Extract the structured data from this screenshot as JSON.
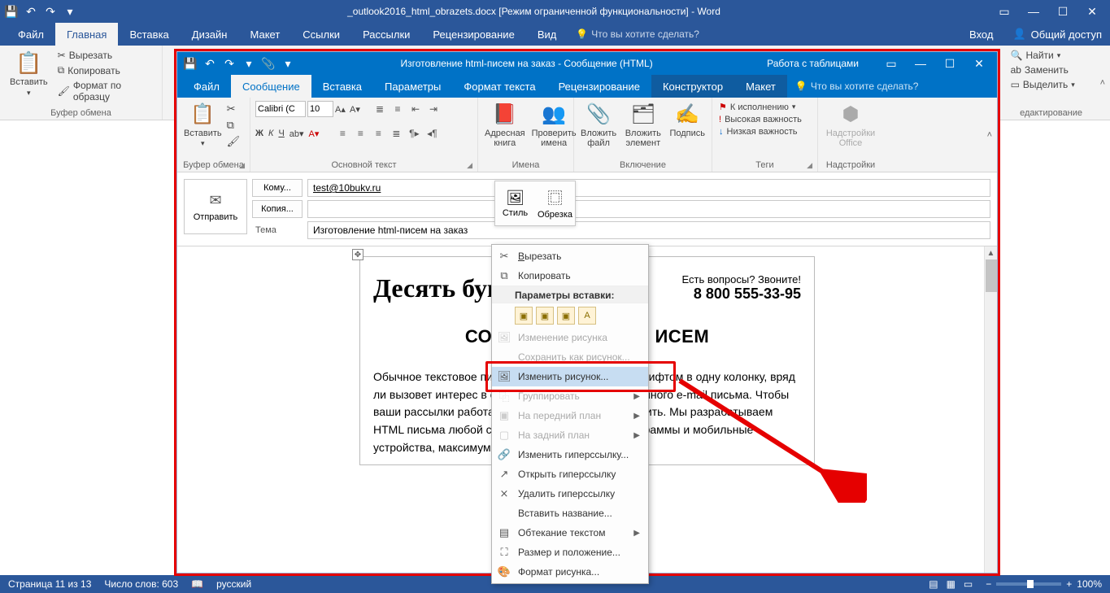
{
  "word": {
    "title": "_outlook2016_html_obrazets.docx [Режим ограниченной функциональности] - Word",
    "tabs": {
      "file": "Файл",
      "home": "Главная",
      "insert": "Вставка",
      "design": "Дизайн",
      "layout": "Макет",
      "references": "Ссылки",
      "mailings": "Рассылки",
      "review": "Рецензирование",
      "view": "Вид",
      "tell": "Что вы хотите сделать?",
      "signin": "Вход",
      "share": "Общий доступ"
    },
    "ribbon": {
      "paste": "Вставить",
      "cut": "Вырезать",
      "copy": "Копировать",
      "formatpainter": "Формат по образцу",
      "clipboard": "Буфер обмена",
      "find": "Найти",
      "replace": "Заменить",
      "select": "Выделить",
      "editing": "едактирование"
    },
    "status": {
      "page": "Страница 11 из 13",
      "words": "Число слов: 603",
      "lang": "русский",
      "zoom": "100%"
    }
  },
  "outlook": {
    "title": "Изготовление html-писем на заказ - Сообщение (HTML)",
    "context": "Работа с таблицами",
    "tabs": {
      "file": "Файл",
      "message": "Сообщение",
      "insert": "Вставка",
      "options": "Параметры",
      "formattext": "Формат текста",
      "review": "Рецензирование",
      "construct": "Конструктор",
      "layout": "Макет",
      "tell": "Что вы хотите сделать?"
    },
    "ribbon": {
      "paste": "Вставить",
      "clipboard": "Буфер обмена",
      "fontname": "Calibri (С",
      "fontsize": "10",
      "basictext": "Основной текст",
      "addrbook": "Адресная книга",
      "checknames": "Проверить имена",
      "names": "Имена",
      "attachfile": "Вложить файл",
      "attachitem": "Вложить элемент",
      "signature": "Подпись",
      "include": "Включение",
      "followup": "К исполнению",
      "highimp": "Высокая важность",
      "lowimp": "Низкая важность",
      "tags": "Теги",
      "addins": "Надстройки Office",
      "addinsgrp": "Надстройки"
    },
    "header": {
      "send": "Отправить",
      "to": "Кому...",
      "cc": "Копия...",
      "subject": "Тема",
      "to_value": "test@10bukv.ru",
      "subject_value": "Изготовление html-писем на заказ"
    },
    "minitoolbar": {
      "style": "Стиль",
      "crop": "Обрезка"
    }
  },
  "email": {
    "logo": "Десять букв",
    "cta_q": "Есть вопросы? Звоните!",
    "phone": "8 800 555-33-95",
    "heading_left": "СОЗ",
    "heading_right": "ИСЕМ",
    "para": "Обычное текстовое письмо, написанное мелким шрифтом в одну колонку, вряд ли вызовет интерес в отличие от красочного рекламного e-mail письма. Чтобы ваши рассылки работали, их нужно красиво оформить. Мы разрабатываем HTML письма любой сложности под почтовые программы и мобильные устройства, максимум, за 3 дня."
  },
  "ctx": {
    "cut": "Вырезать",
    "copy": "Копировать",
    "pastehdr": "Параметры вставки:",
    "changepic": "Изменение рисунка",
    "saveas": "Сохранить как рисунок...",
    "change": "Изменить рисунок...",
    "group": "Группировать",
    "front": "На передний план",
    "back": "На задний план",
    "edithyper": "Изменить гиперссылку...",
    "openhyper": "Открыть гиперссылку",
    "removehyper": "Удалить гиперссылку",
    "insertcaption": "Вставить название...",
    "wrap": "Обтекание текстом",
    "sizepos": "Размер и положение...",
    "formatpic": "Формат рисунка..."
  }
}
